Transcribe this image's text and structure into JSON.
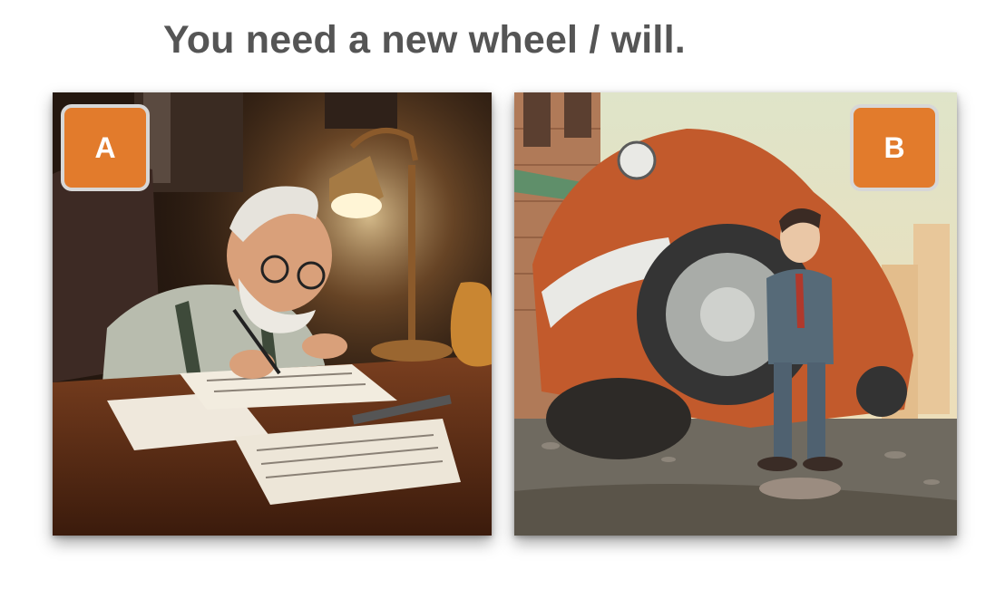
{
  "prompt": {
    "title": "You need a new wheel / will."
  },
  "options": [
    {
      "label": "A",
      "image_subject": "old-man-writing-will-illustration"
    },
    {
      "label": "B",
      "image_subject": "man-beside-car-with-giant-wheel-illustration"
    }
  ],
  "colors": {
    "badge": "#e27b2c",
    "badge_border": "#d7d7d7",
    "title_text": "#555555"
  }
}
